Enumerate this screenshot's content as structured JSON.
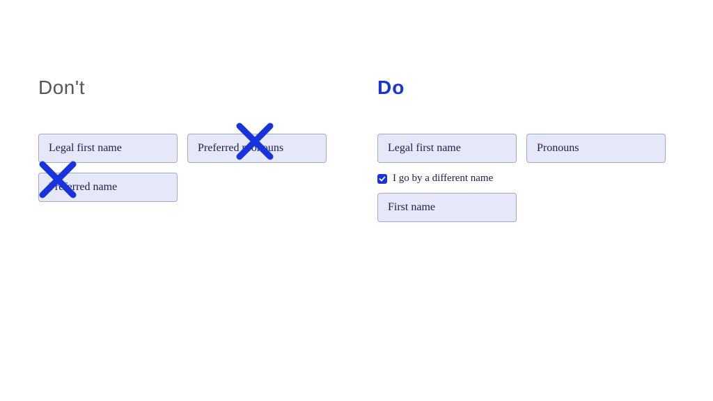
{
  "dont": {
    "heading": "Don't",
    "fields": {
      "legal_first_name": "Legal first name",
      "preferred_pronouns": "Preferred pronouns",
      "preferred_name": "Preferred name"
    }
  },
  "do": {
    "heading": "Do",
    "fields": {
      "legal_first_name": "Legal first name",
      "pronouns": "Pronouns",
      "first_name": "First name"
    },
    "checkbox_label": "I go by a different name"
  },
  "colors": {
    "accent": "#1633dd",
    "field_bg": "#e6e8f7",
    "field_border": "#a2a8cc",
    "text": "#1a1f4d"
  }
}
